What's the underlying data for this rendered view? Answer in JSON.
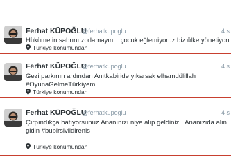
{
  "tweets": [
    {
      "name": "Ferhat KÜPOĞLU",
      "handle": "@ferhatkupoglu",
      "time": "4 s",
      "text": "Hükümetin sabrını zorlamayın....çocuk eğlemiyoruz biz ülke yönetiyoruz",
      "location": "Türkiye konumundan"
    },
    {
      "name": "Ferhat KÜPOĞLU",
      "handle": "@ferhatkupoglu",
      "time": "4 s",
      "text_line1": "Gezi parkının ardından Anıtkabiride yıkarsak elhamdülillah",
      "text_line2": "#OyunaGelmeTürkiyem",
      "location": "Türkiye konumundan"
    },
    {
      "name": "Ferhat KÜPOĞLU",
      "handle": "@ferhatkupoglu",
      "time": "4 s",
      "text_line1": "Çırpındıkça batıyorsunuz.Ananınızı niye alıp geldiniz...Ananızıda alın",
      "text_line2": "gidin  #bubirsivildirenis",
      "location": "Türkiye konumundan"
    }
  ],
  "colors": {
    "divider": "#c8402f",
    "name": "#292f33",
    "meta": "#8899a6"
  },
  "icons": {
    "avatar": "avatar-photo",
    "location": "location-pin-icon"
  }
}
